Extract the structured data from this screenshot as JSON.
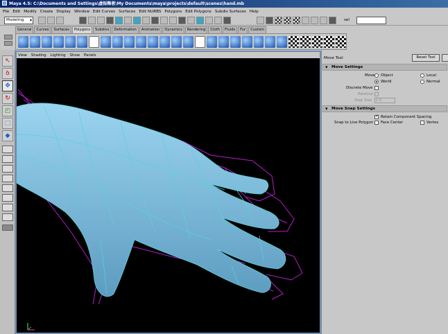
{
  "window": {
    "title": "Maya 4.5: C:\\Documents and Settings\\虚拟舞者\\My Documents\\maya\\projects\\default\\scenes\\hand.mb"
  },
  "menu": [
    "File",
    "Edit",
    "Modify",
    "Create",
    "Display",
    "Window",
    "Edit Curves",
    "Surfaces",
    "Edit NURBS",
    "Polygons",
    "Edit Polygons",
    "Subdiv Surfaces",
    "Help"
  ],
  "status_line": {
    "mode": "Modeling",
    "selection_label": "sel"
  },
  "shelf_tabs": [
    "General",
    "Curves",
    "Surfaces",
    "Polygons",
    "Subdivs",
    "Deformation",
    "Animation",
    "Dynamics",
    "Rendering",
    "Cloth",
    "Fluids",
    "Fur",
    "Custom"
  ],
  "active_shelf": "Polygons",
  "panel_menu": [
    "View",
    "Shading",
    "Lighting",
    "Show",
    "Panels"
  ],
  "tool_settings": {
    "title": "Move Tool",
    "reset_button": "Reset Tool",
    "move_settings": {
      "header": "Move Settings",
      "move_label": "Move",
      "options": [
        "Object",
        "Local",
        "World",
        "Normal"
      ],
      "selected": "World",
      "discrete_move_label": "Discrete Move",
      "discrete_move_checked": false,
      "relative_label": "Relative",
      "step_size_label": "Step Size",
      "step_size_value": "1.0"
    },
    "move_snap_settings": {
      "header": "Move Snap Settings",
      "retain_spacing_label": "Retain Component Spacing",
      "retain_spacing_checked": true,
      "snap_live_label": "Snap to Live Polygon",
      "face_center_label": "Face Center",
      "face_center_checked": false,
      "vertex_label": "Vertex",
      "vertex_checked": false
    }
  },
  "colors": {
    "viewport_bg": "#000000",
    "mesh": "#8ec8e6",
    "cage": "#b41ec8",
    "wire": "#5ad2d8",
    "panel_border": "#6c8fb5"
  }
}
